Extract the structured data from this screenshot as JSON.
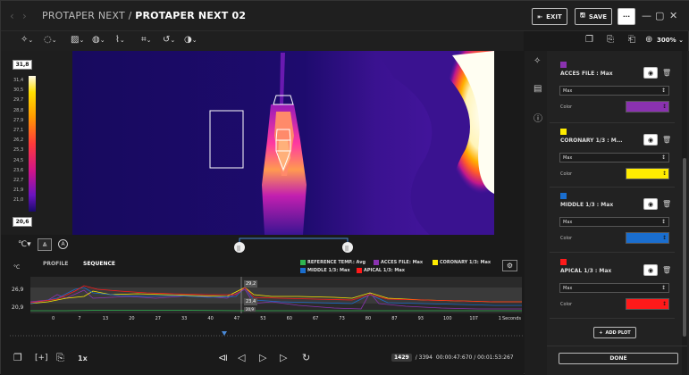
{
  "titlebar": {
    "back_icon": "chevron-left-icon",
    "forward_icon": "chevron-right-icon",
    "parent": "PROTAPER NEXT",
    "separator": "/",
    "current": "PROTAPER NEXT 02",
    "exit_label": "EXIT",
    "save_label": "SAVE",
    "more_label": "···",
    "minimize": "—",
    "maximize": "▢",
    "close": "✕"
  },
  "toolbar": {
    "tools": [
      {
        "icon": "crosshair-icon",
        "glyph": "✧"
      },
      {
        "icon": "lasso-icon",
        "glyph": "◌"
      },
      {
        "icon": "image-adjust-icon",
        "glyph": "▨"
      },
      {
        "icon": "palette-icon",
        "glyph": "◍"
      },
      {
        "icon": "measure-icon",
        "glyph": "⌇"
      },
      {
        "icon": "crop-icon",
        "glyph": "⌗"
      },
      {
        "icon": "rotate-icon",
        "glyph": "↺"
      },
      {
        "icon": "circle-half-icon",
        "glyph": "◑"
      }
    ],
    "chevron": "⌄",
    "zoom_label": "300%"
  },
  "scale": {
    "max": "31,8",
    "min": "20,6",
    "ticks": [
      "31,4",
      "30,5",
      "29,7",
      "28,8",
      "27,9",
      "27,1",
      "26,2",
      "25,3",
      "24,5",
      "23,6",
      "22,7",
      "21,9",
      "21,0"
    ]
  },
  "timeline": {
    "axis_unit": "°C",
    "tabs": [
      {
        "label": "PROFILE"
      },
      {
        "label": "SEQUENCE"
      }
    ],
    "legend": [
      {
        "label": "REFERENCE TEMP.: Avg",
        "color": "#2fb550"
      },
      {
        "label": "ACCES FILE: Max",
        "color": "#8a32b0"
      },
      {
        "label": "CORONARY 1/3: Max",
        "color": "#ffec00"
      },
      {
        "label": "MIDDLE 1/3: Max",
        "color": "#1a6ecf"
      },
      {
        "label": "APICAL 1/3: Max",
        "color": "#ff1a1a"
      }
    ],
    "y_labels": [
      "26,9",
      "20,9"
    ],
    "x_labels": [
      "0",
      "7",
      "13",
      "20",
      "27",
      "33",
      "40",
      "47",
      "53",
      "60",
      "67",
      "73",
      "80",
      "87",
      "93",
      "100",
      "107",
      "1"
    ],
    "x_unit": "Seconds",
    "cursor_high": "29,2",
    "cursor_low": "23,4",
    "cursor_lowest": "20,9"
  },
  "playback": {
    "speed": "1x",
    "frame": "1429",
    "total_frames": "/ 3394",
    "time": "00:00:47:670 / 00:01:53:267"
  },
  "rois": [
    {
      "name": "ACCES FILE : Max",
      "mode": "Max",
      "color_label": "Color",
      "color": "#8a32b0"
    },
    {
      "name": "CORONARY 1/3 : M...",
      "mode": "Max",
      "color_label": "Color",
      "color": "#ffec00"
    },
    {
      "name": "MIDDLE 1/3 : Max",
      "mode": "Max",
      "color_label": "Color",
      "color": "#1a6ecf"
    },
    {
      "name": "APICAL 1/3 : Max",
      "mode": "Max",
      "color_label": "Color",
      "color": "#ff1a1a"
    }
  ],
  "panel": {
    "add_plot": "ADD PLOT",
    "done": "DONE"
  }
}
